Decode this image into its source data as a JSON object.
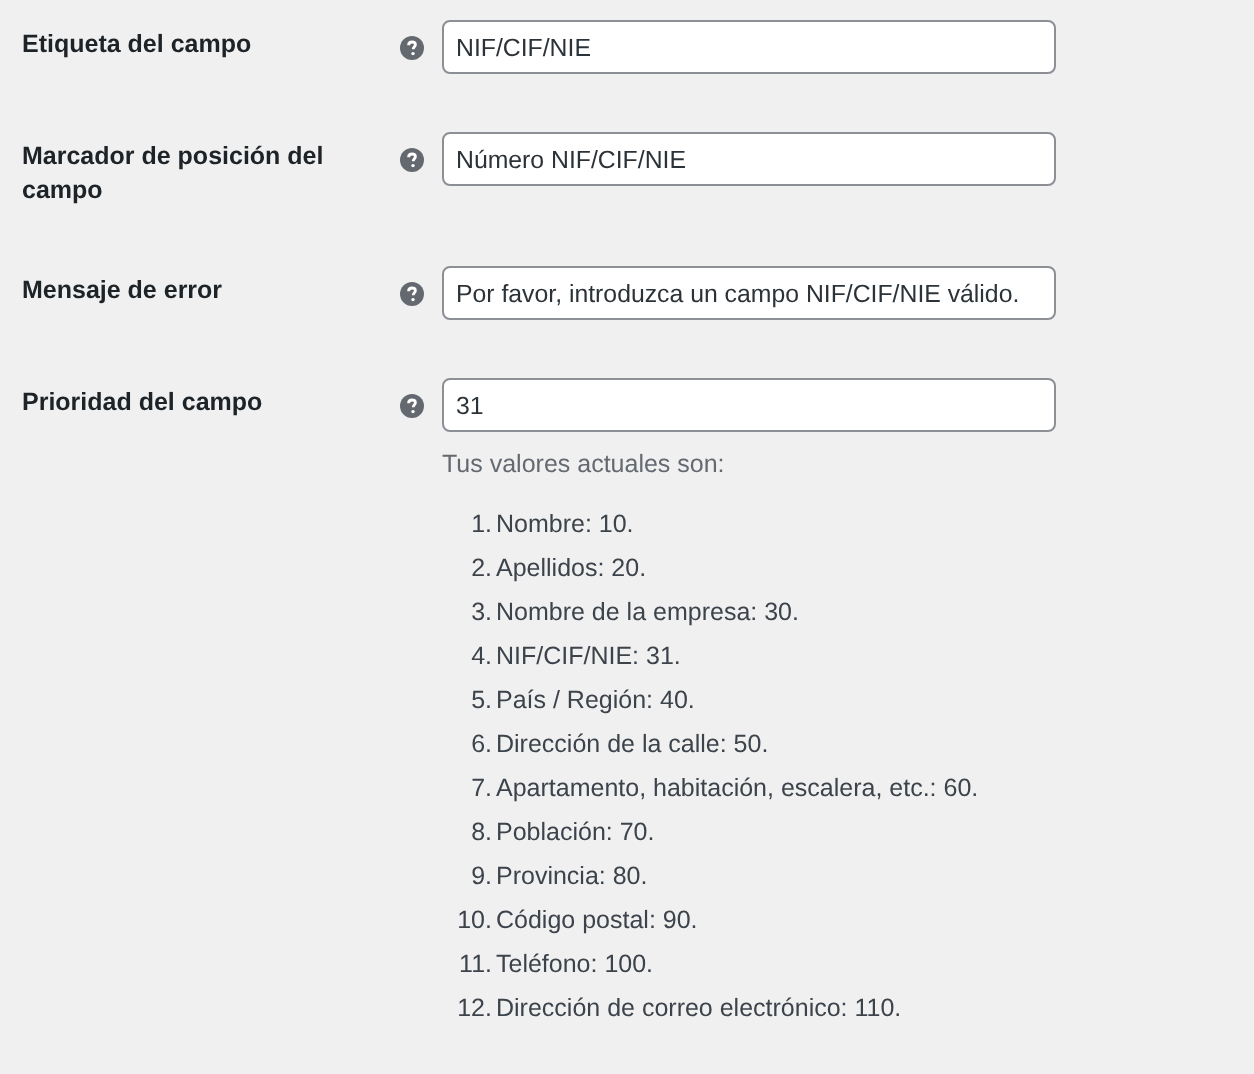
{
  "fields": [
    {
      "label": "Etiqueta del campo",
      "value": "NIF/CIF/NIE"
    },
    {
      "label": "Marcador de posición del campo",
      "value": "Número NIF/CIF/NIE"
    },
    {
      "label": "Mensaje de error",
      "value": "Por favor, introduzca un campo NIF/CIF/NIE válido."
    },
    {
      "label": "Prioridad del campo",
      "value": "31",
      "description": "Tus valores actuales son:",
      "list": [
        {
          "number": "1.",
          "text": "Nombre: 10."
        },
        {
          "number": "2.",
          "text": "Apellidos: 20."
        },
        {
          "number": "3.",
          "text": "Nombre de la empresa: 30."
        },
        {
          "number": "4.",
          "text": "NIF/CIF/NIE: 31."
        },
        {
          "number": "5.",
          "text": "País / Región: 40."
        },
        {
          "number": "6.",
          "text": "Dirección de la calle: 50."
        },
        {
          "number": "7.",
          "text": "Apartamento, habitación, escalera, etc.: 60."
        },
        {
          "number": "8.",
          "text": "Población: 70."
        },
        {
          "number": "9.",
          "text": "Provincia: 80."
        },
        {
          "number": "10.",
          "text": "Código postal: 90."
        },
        {
          "number": "11.",
          "text": "Teléfono: 100."
        },
        {
          "number": "12.",
          "text": "Dirección de correo electrónico: 110."
        }
      ]
    }
  ]
}
